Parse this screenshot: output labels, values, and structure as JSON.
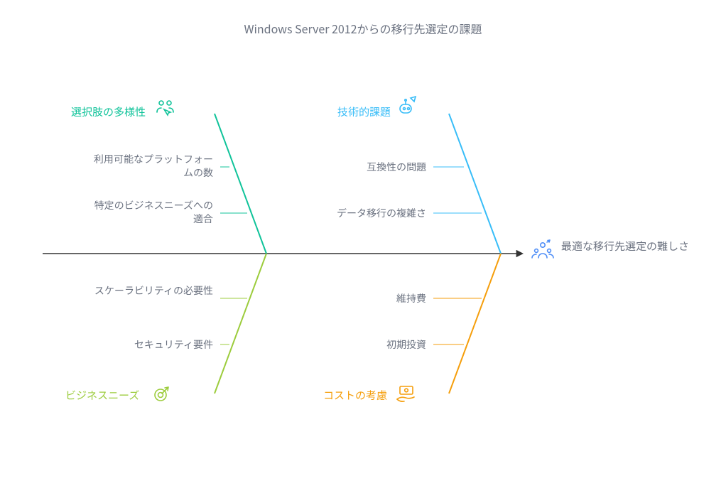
{
  "chart_data": {
    "type": "fishbone",
    "title": "Windows Server 2012からの移行先選定の課題",
    "effect": "最適な移行先選定の難しさ",
    "categories": [
      {
        "id": "top_left",
        "label": "選択肢の多様性",
        "color": "#10c39a",
        "position": "top-left",
        "icon": "people-cursor-icon",
        "causes": [
          "利用可能なプラットフォームの数",
          "特定のビジネスニーズへの適合"
        ]
      },
      {
        "id": "top_right",
        "label": "技術的課題",
        "color": "#38bdf8",
        "position": "top-right",
        "icon": "robot-arrow-icon",
        "causes": [
          "互換性の問題",
          "データ移行の複雑さ"
        ]
      },
      {
        "id": "bottom_left",
        "label": "ビジネスニーズ",
        "color": "#9ccc3c",
        "position": "bottom-left",
        "icon": "target-arrow-icon",
        "causes": [
          "スケーラビリティの必要性",
          "セキュリティ要件"
        ]
      },
      {
        "id": "bottom_right",
        "label": "コストの考慮",
        "color": "#f59e0b",
        "position": "bottom-right",
        "icon": "money-hand-icon",
        "causes": [
          "維持費",
          "初期投資"
        ]
      }
    ]
  },
  "title": "Windows Server 2012からの移行先選定の課題",
  "effect": "最適な移行先選定の難しさ",
  "tl_label": "選択肢の多様性",
  "tr_label": "技術的課題",
  "bl_label": "ビジネスニーズ",
  "br_label": "コストの考慮",
  "tl_c1": "利用可能なプラットフォームの数",
  "tl_c2": "特定のビジネスニーズへの適合",
  "tr_c1": "互換性の問題",
  "tr_c2": "データ移行の複雑さ",
  "bl_c1": "スケーラビリティの必要性",
  "bl_c2": "セキュリティ要件",
  "br_c1": "維持費",
  "br_c2": "初期投資",
  "colors": {
    "green": "#10c39a",
    "blue": "#38bdf8",
    "lime": "#9ccc3c",
    "orange": "#f59e0b",
    "spine": "#333333"
  }
}
